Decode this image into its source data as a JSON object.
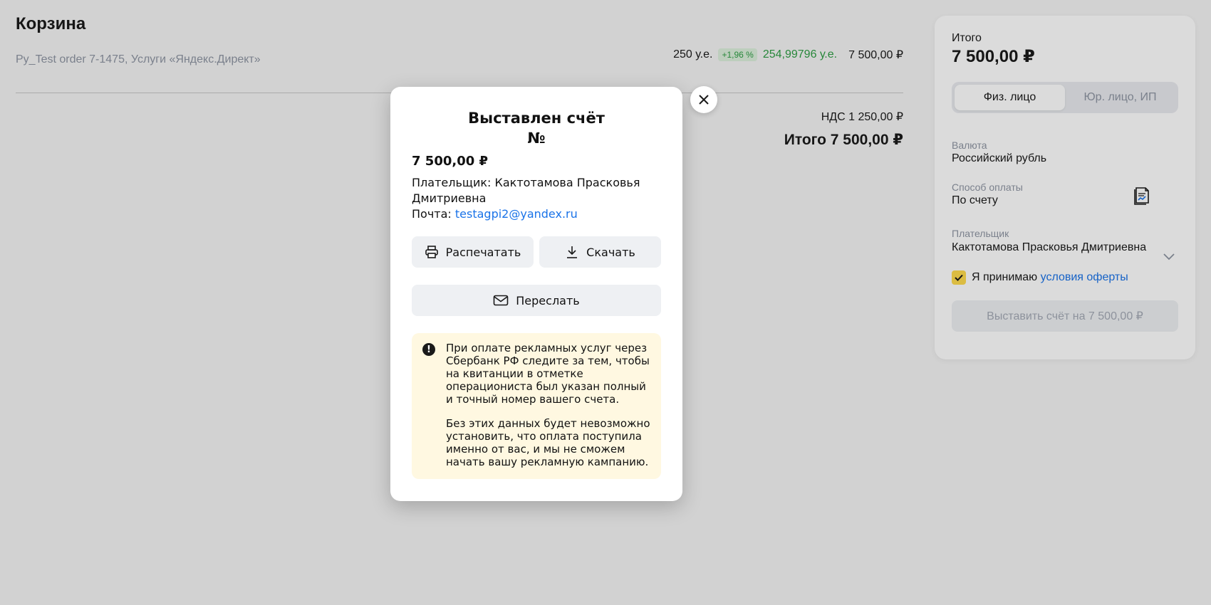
{
  "page": {
    "title": "Корзина",
    "subtitle": "Ру_Test order 7-1475, Услуги «Яндекс.Директ»",
    "price_base": "250 у.е.",
    "price_pct": "+1,96 %",
    "price_new": "254,99796 у.е.",
    "price_rub": "7 500,00 ₽",
    "vat": "НДС 1 250,00 ₽",
    "total": "Итого 7 500,00 ₽"
  },
  "sidebar": {
    "label": "Итого",
    "total": "7 500,00 ₽",
    "seg_person": "Физ. лицо",
    "seg_company": "Юр. лицо, ИП",
    "currency_label": "Валюта",
    "currency_value": "Российский рубль",
    "payment_label": "Способ оплаты",
    "payment_value": "По счету",
    "payer_label": "Плательщик",
    "payer_value": "Кактотамова Прасковья Дмитриевна",
    "accept_text": "Я принимаю",
    "accept_link": "условия оферты",
    "submit_label": "Выставить счёт на 7 500,00 ₽"
  },
  "modal": {
    "title": "Выставлен счёт",
    "number": "№",
    "amount": "7 500,00 ₽",
    "payer_label": "Плательщик:",
    "payer_name": "Кактотамова Прасковья Дмитриевна",
    "email_label": "Почта:",
    "email": "testagpi2@yandex.ru",
    "print_label": "Распечатать",
    "download_label": "Скачать",
    "forward_label": "Переслать",
    "warning_p1": "При оплате рекламных услуг через Сбербанк РФ следите за тем, чтобы на квитанции в отметке операциониста был указан полный и точный номер вашего счета.",
    "warning_p2": "Без этих данных будет невозможно установить, что оплата поступила именно от вас, и мы не сможем начать вашу рекламную кампанию."
  },
  "colors": {
    "accent": "#ffdb4d",
    "link": "#1a73e8",
    "success": "#2e9e44",
    "warning_bg": "#fff8e1"
  }
}
